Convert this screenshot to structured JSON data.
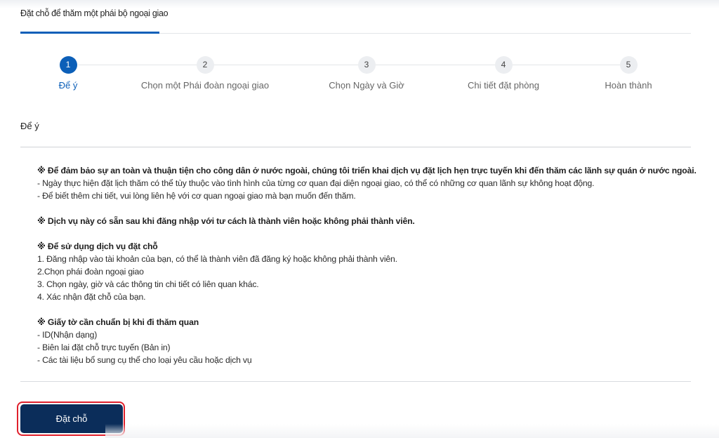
{
  "tabs": [
    {
      "label": "Đặt chỗ để thăm một phái bộ ngoại giao",
      "active": true
    }
  ],
  "steps": [
    {
      "number": "1",
      "label": "Để ý",
      "active": true
    },
    {
      "number": "2",
      "label": "Chọn một Phái đoàn ngoại giao",
      "active": false
    },
    {
      "number": "3",
      "label": "Chọn Ngày và Giờ",
      "active": false
    },
    {
      "number": "4",
      "label": "Chi tiết đặt phòng",
      "active": false
    },
    {
      "number": "5",
      "label": "Hoàn thành",
      "active": false
    }
  ],
  "section_title": "Để ý",
  "notice": {
    "p1": {
      "heading": "※ Để đảm bảo sự an toàn và thuận tiện cho công dân ở nước ngoài, chúng tôi triển khai dịch vụ đặt lịch hẹn trực tuyến khi đến thăm các lãnh sự quán ở nước ngoài.",
      "lines": [
        "- Ngày thực hiện đặt lịch thăm có thể tùy thuộc vào tình hình của từng cơ quan đại diện ngoại giao, có thể có những cơ quan lãnh sự không hoạt động.",
        "- Để biết thêm chi tiết, vui lòng liên hệ với cơ quan ngoại giao mà bạn muốn đến thăm."
      ]
    },
    "p2": {
      "heading": "※ Dịch vụ này có sẵn sau khi đăng nhập với tư cách là thành viên hoặc không phải thành viên."
    },
    "p3": {
      "heading": "※ Để sử dụng dịch vụ đặt chỗ",
      "lines": [
        "1. Đăng nhập vào tài khoản của bạn, có thể là thành viên đã đăng ký hoặc không phải thành viên.",
        "2.Chọn phái đoàn ngoại giao",
        "3. Chọn ngày, giờ và các thông tin chi tiết có liên quan khác.",
        "4. Xác nhận đặt chỗ của bạn."
      ]
    },
    "p4": {
      "heading": "※ Giấy tờ cần chuẩn bị khi đi thăm quan",
      "lines": [
        "- ID(Nhận dạng)",
        "- Biên lai đặt chỗ trực tuyến (Bản in)",
        "- Các tài liệu bổ sung cụ thể cho loại yêu cầu hoặc dịch vụ"
      ]
    }
  },
  "book_button_label": "Đặt chỗ",
  "colors": {
    "accent": "#0c5fb8",
    "button_bg": "#0b2d5a",
    "highlight": "#e0202c"
  }
}
